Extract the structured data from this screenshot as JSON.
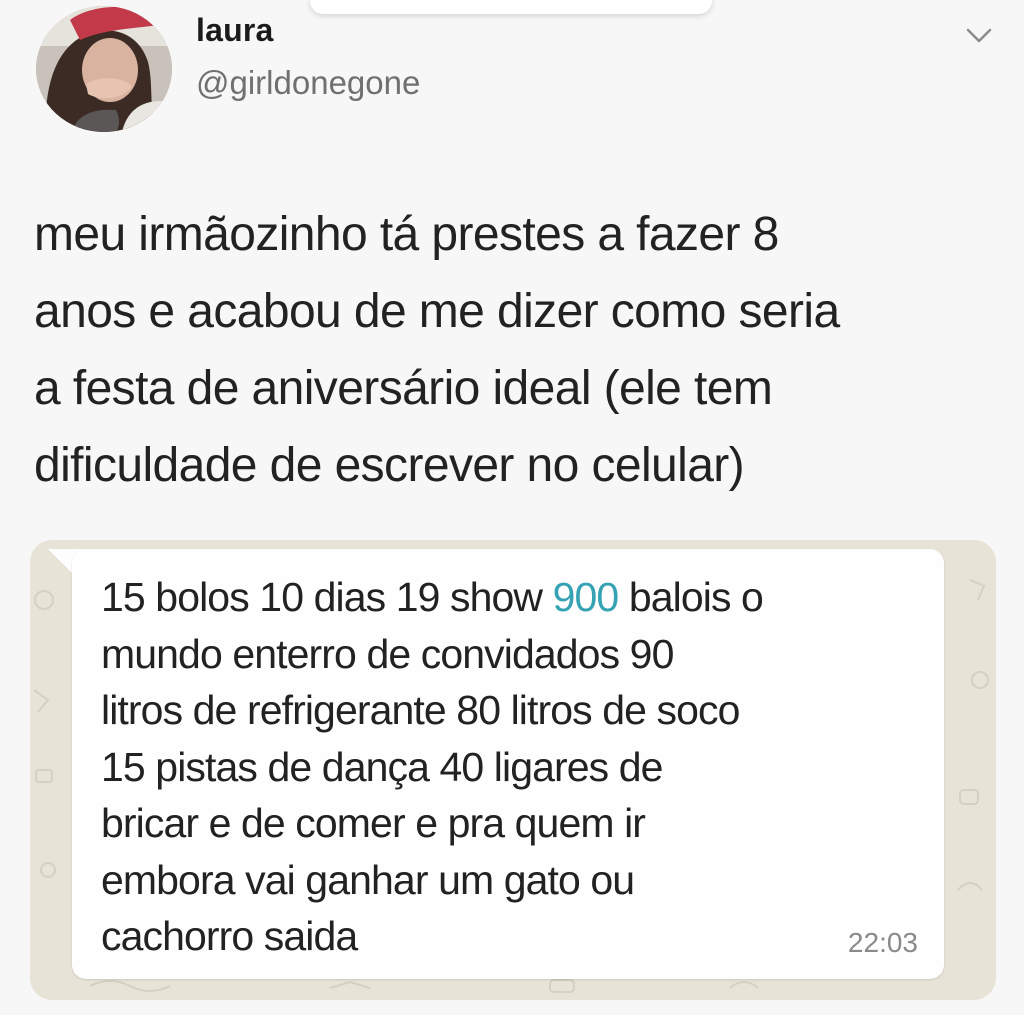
{
  "tweet": {
    "author": {
      "display_name": "laura",
      "handle": "@girldonegone"
    },
    "text_lines": [
      "meu irmãozinho tá prestes a fazer 8",
      "anos e acabou de me dizer como seria",
      "a festa de aniversário ideal (ele tem",
      "dificuldade de escrever no celular)"
    ]
  },
  "chat_message": {
    "lines": [
      {
        "before": "15 bolos 10 dias 19 show ",
        "number": "900",
        "after": " balois o"
      },
      {
        "text": "mundo enterro de convidados  90"
      },
      {
        "text": "litros de refrigerante 80  litros de soco"
      },
      {
        "text": "15  pistas de dança 40 ligares de"
      },
      {
        "text": "bricar e de comer e pra quem ir"
      },
      {
        "text": "embora vai ganhar um gato ou"
      },
      {
        "text": "cachorro saida"
      }
    ],
    "time": "22:03"
  },
  "colors": {
    "link_number": "#35a3b3",
    "chat_wallpaper": "#e8e3d7",
    "bubble": "#fefefe"
  },
  "icons": {
    "menu": "chevron-down-icon",
    "avatar": "profile-photo"
  }
}
